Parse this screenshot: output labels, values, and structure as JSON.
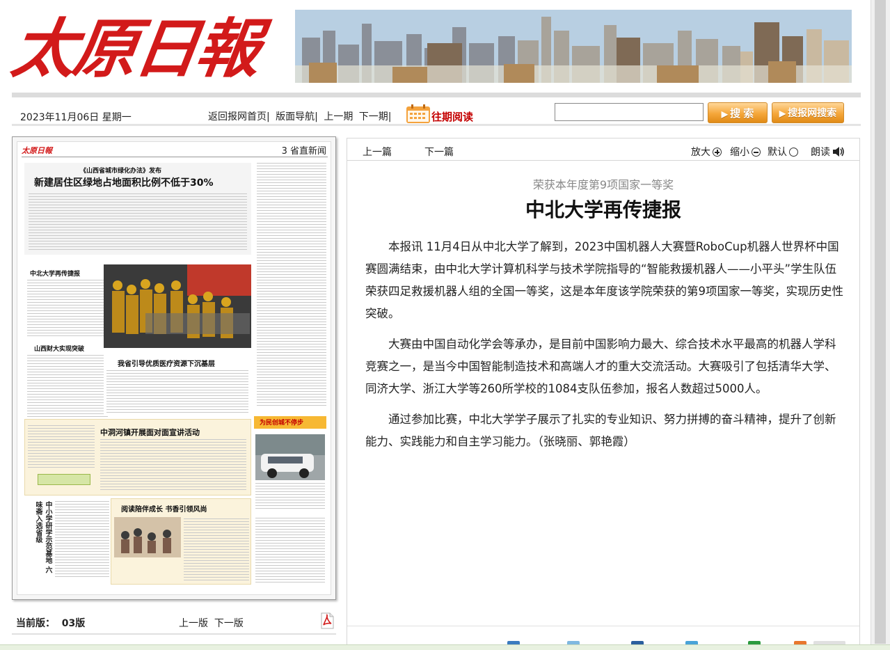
{
  "header": {
    "masthead": "太原日報",
    "date": "2023年11月06日 星期一",
    "nav_links": [
      "返回报网首页|",
      "版面导航|",
      "上一期",
      "下一期|"
    ],
    "archive_label": "往期阅读",
    "search_placeholder": "",
    "search_button": "搜 索",
    "network_search_button": "搜报网搜索"
  },
  "newspaper_page": {
    "logo": "太原日報",
    "page_label": "3 省直新闻",
    "headline_small": "《山西省城市绿化办法》发布",
    "headline_main": "新建居住区绿地占地面积比例不低于30%",
    "story2_title": "中北大学再传捷报",
    "story3_title": "山西财大实现突破",
    "story4_title": "我省引导优质医疗资源下沉基层",
    "story5_title": "中洞河镇开展面对面宣讲活动",
    "story6_title": "阅读陪伴成长  书香引领风尚",
    "story7_title": "中小学研学示范基地 六味斋入选省级",
    "banner_red": "为民创城不停步"
  },
  "left_footer": {
    "current_version_label": "当前版：",
    "current_version": "03版",
    "prev_version": "上一版",
    "next_version": "下一版"
  },
  "article": {
    "toolbar": {
      "prev": "上一篇",
      "next": "下一篇",
      "zoom_in": "放大",
      "zoom_out": "缩小",
      "default": "默认",
      "read_aloud": "朗读"
    },
    "subtitle": "荣获本年度第9项国家一等奖",
    "title": "中北大学再传捷报",
    "paragraphs": [
      "本报讯 11月4日从中北大学了解到，2023中国机器人大赛暨RoboCup机器人世界杯中国赛圆满结束，由中北大学计算机科学与技术学院指导的“智能救援机器人——小平头”学生队伍荣获四足救援机器人组的全国一等奖，这是本年度该学院荣获的第9项国家一等奖，实现历史性突破。",
      "大赛由中国自动化学会等承办，是目前中国影响力最大、综合技术水平最高的机器人学科竞赛之一，是当今中国智能制造技术和高端人才的重大交流活动。大赛吸引了包括清华大学、同济大学、浙江大学等260所学校的1084支队伍参加，报名人数超过5000人。",
      "通过参加比赛，中北大学学子展示了扎实的专业知识、努力拼搏的奋斗精神，提升了创新能力、实践能力和自主学习能力。（张晓丽、郭艳霞）"
    ]
  },
  "colors": {
    "masthead_red": "#d21a1a",
    "archive_red": "#c40000",
    "button_orange": "#f5a73a"
  }
}
